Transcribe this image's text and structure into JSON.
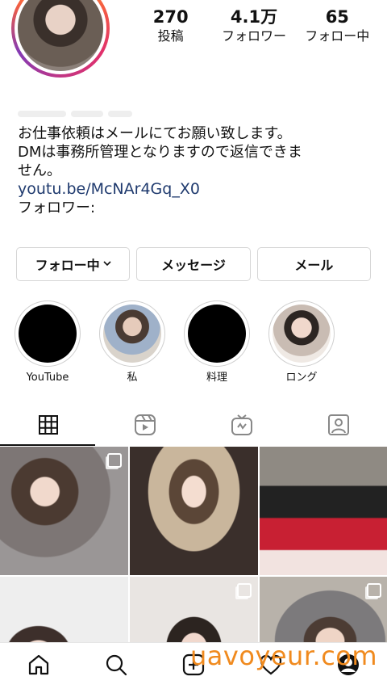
{
  "profile": {
    "stats": [
      {
        "value": "270",
        "label": "投稿"
      },
      {
        "value": "4.1万",
        "label": "フォロワー"
      },
      {
        "value": "65",
        "label": "フォロー中"
      }
    ],
    "bio_lines": [
      "お仕事依頼はメールにてお願い致します。",
      "DMは事務所管理となりますので返信できま",
      "せん。"
    ],
    "link": "youtu.be/McNAr4Gq_X0",
    "followers_line": "フォロワー:"
  },
  "actions": {
    "following_label": "フォロー中",
    "message_label": "メッセージ",
    "email_label": "メール"
  },
  "highlights": [
    {
      "label": "YouTube"
    },
    {
      "label": "私"
    },
    {
      "label": "料理"
    },
    {
      "label": "ロング"
    }
  ],
  "tabs": [
    "grid-icon",
    "reels-icon",
    "igtv-icon",
    "tagged-icon"
  ],
  "watermark": "uavoyeur.com",
  "colors": {
    "link": "#1f3a6e",
    "watermark": "#f08a1e"
  }
}
